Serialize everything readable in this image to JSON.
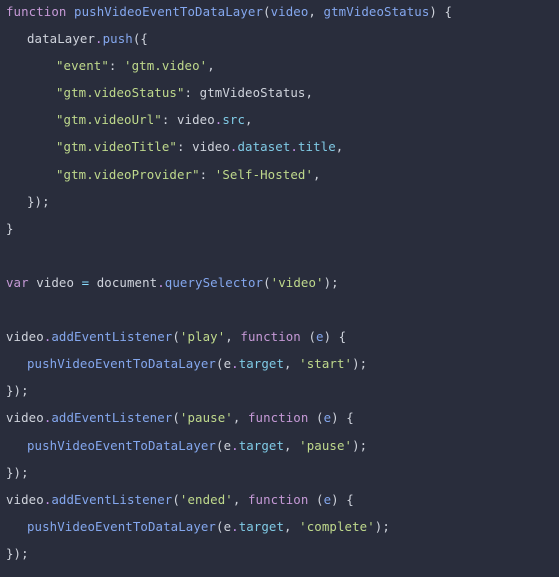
{
  "code": {
    "language": "javascript",
    "lines": [
      "function pushVideoEventToDataLayer(video, gtmVideoStatus) {",
      "   dataLayer.push({",
      "       \"event\": 'gtm.video',",
      "       \"gtm.videoStatus\": gtmVideoStatus,",
      "       \"gtm.videoUrl\": video.src,",
      "       \"gtm.videoTitle\": video.dataset.title,",
      "       \"gtm.videoProvider\": 'Self-Hosted',",
      "   });",
      "}",
      "",
      "var video = document.querySelector('video');",
      "",
      "video.addEventListener('play', function (e) {",
      "   pushVideoEventToDataLayer(e.target, 'start');",
      "});",
      "video.addEventListener('pause', function (e) {",
      "   pushVideoEventToDataLayer(e.target, 'pause');",
      "});",
      "video.addEventListener('ended', function (e) {",
      "   pushVideoEventToDataLayer(e.target, 'complete');",
      "});"
    ],
    "tokens": {
      "kw_function": "function",
      "kw_var": "var",
      "fn_name": "pushVideoEventToDataLayer",
      "param_video": "video",
      "param_status": "gtmVideoStatus",
      "dataLayer": "dataLayer",
      "push": "push",
      "key_event": "\"event\"",
      "val_event": "'gtm.video'",
      "key_status": "\"gtm.videoStatus\"",
      "val_status": "gtmVideoStatus",
      "key_url": "\"gtm.videoUrl\"",
      "key_title": "\"gtm.videoTitle\"",
      "key_provider": "\"gtm.videoProvider\"",
      "val_provider": "'Self-Hosted'",
      "src": "src",
      "dataset": "dataset",
      "title": "title",
      "document": "document",
      "querySelector": "querySelector",
      "str_video": "'video'",
      "addEventListener": "addEventListener",
      "ev_play": "'play'",
      "ev_pause": "'pause'",
      "ev_ended": "'ended'",
      "e": "e",
      "target": "target",
      "st_start": "'start'",
      "st_pause": "'pause'",
      "st_complete": "'complete'"
    }
  },
  "colors": {
    "background": "#292d3c",
    "text": "#cfd3dc",
    "keyword": "#c599d6",
    "function": "#84a7ee",
    "property": "#80cbe6",
    "string": "#bfd98c"
  }
}
